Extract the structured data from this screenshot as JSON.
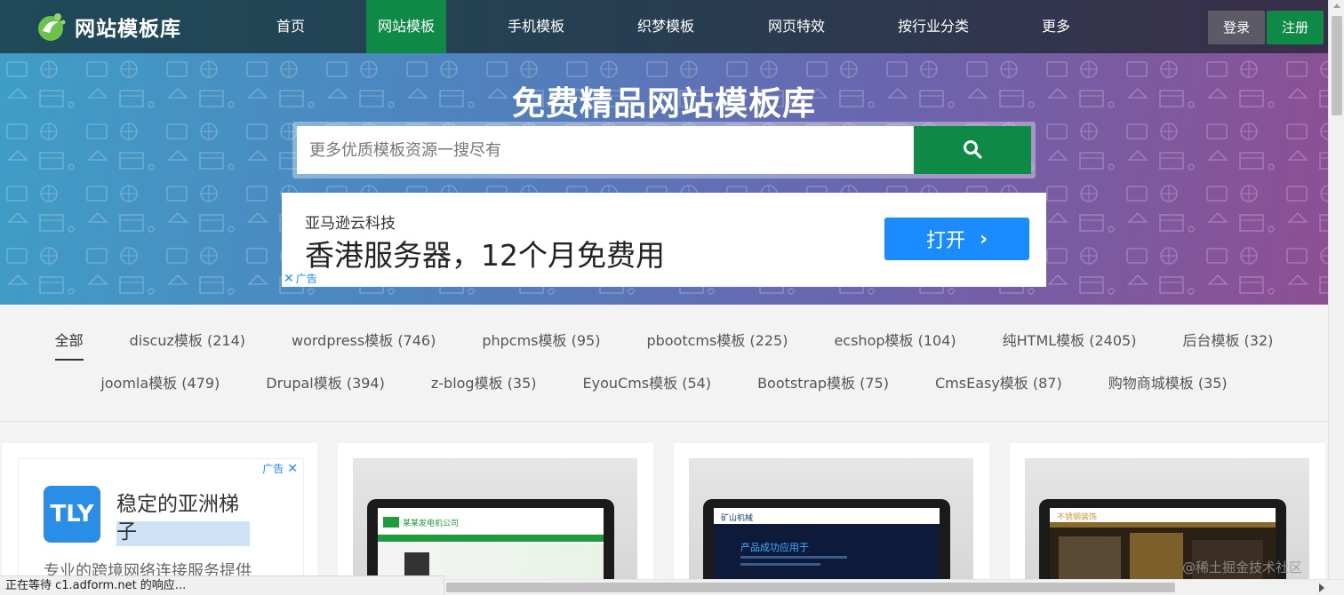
{
  "header": {
    "logo_text": "网站模板库",
    "nav": [
      {
        "label": "首页",
        "active": false
      },
      {
        "label": "网站模板",
        "active": true
      },
      {
        "label": "手机模板",
        "active": false
      },
      {
        "label": "织梦模板",
        "active": false
      },
      {
        "label": "网页特效",
        "active": false
      },
      {
        "label": "按行业分类",
        "active": false
      },
      {
        "label": "更多",
        "active": false
      }
    ],
    "login_label": "登录",
    "register_label": "注册"
  },
  "hero": {
    "title": "免费精品网站模板库",
    "search_placeholder": "更多优质模板资源一搜尽有"
  },
  "hero_ad": {
    "company": "亚马逊云科技",
    "headline": "香港服务器，12个月免费用",
    "button_label": "打开",
    "ad_mark": "广告"
  },
  "categories": {
    "row1": [
      "全部",
      "discuz模板 (214)",
      "wordpress模板 (746)",
      "phpcms模板 (95)",
      "pbootcms模板 (225)",
      "ecshop模板 (104)",
      "纯HTML模板 (2405)",
      "后台模板 (32)"
    ],
    "row2": [
      "joomla模板 (479)",
      "Drupal模板 (394)",
      "z-blog模板 (35)",
      "EyouCms模板 (54)",
      "Bootstrap模板 (75)",
      "CmsEasy模板 (87)",
      "购物商城模板 (35)"
    ]
  },
  "card_ad": {
    "ad_tag": "广告",
    "logo_text": "TLY",
    "title": "稳定的亚洲梯子",
    "desc": "专业的跨境网络连接服务提供"
  },
  "thumbs": [
    {
      "company": "某某发电机公司",
      "color": "#1e9b3a"
    },
    {
      "slogan": "产品成功应用于",
      "brand": "矿山机械",
      "color": "#0d1a3a"
    },
    {
      "brand": "不锈钢装饰",
      "color": "#2a2016"
    }
  ],
  "status": {
    "text": "正在等待 c1.adform.net 的响应...",
    "watermark": "@稀土掘金技术社区"
  },
  "colors": {
    "brand_green": "#0f8a46",
    "ad_blue": "#1a8cff"
  }
}
